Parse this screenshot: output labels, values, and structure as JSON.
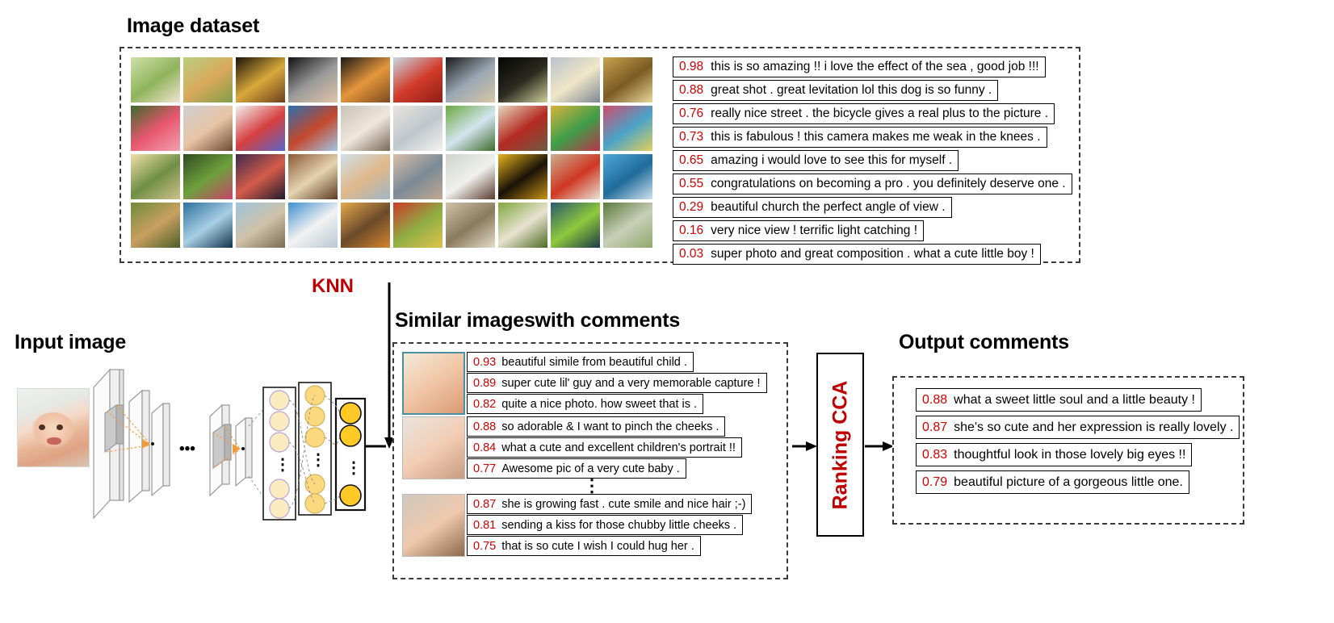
{
  "sections": {
    "dataset_title": "Image dataset",
    "input_title": "Input image",
    "similar_title": "Similar imageswith comments",
    "output_title": "Output comments",
    "knn_label": "KNN",
    "ranking_label": "Ranking CCA"
  },
  "colors": {
    "score_red": "#d00000",
    "label_red": "#c00000",
    "box_border": "#000000",
    "dash_border": "#3a3a3a",
    "neuron_yellow": "#ffc926",
    "neuron_pale": "#fcd97f",
    "neuron_lighter": "#fde8b5"
  },
  "dataset_comments": [
    {
      "score": "0.98",
      "text": "this is so amazing !! i love the effect of the sea , good job !!!"
    },
    {
      "score": "0.88",
      "text": "great shot . great levitation lol this dog is so funny ."
    },
    {
      "score": "0.76",
      "text": "really nice street . the bicycle gives a real plus to the picture ."
    },
    {
      "score": "0.73",
      "text": "this is fabulous ! this camera makes me weak in the knees ."
    },
    {
      "score": "0.65",
      "text": "amazing i would love to see this for myself ."
    },
    {
      "score": "0.55",
      "text": "congratulations on becoming a pro . you definitely deserve one ."
    },
    {
      "score": "0.29",
      "text": "beautiful church the perfect angle of view ."
    },
    {
      "score": "0.16",
      "text": "very nice view ! terrific light catching !"
    },
    {
      "score": "0.03",
      "text": "super photo and great composition . what a cute little boy !"
    }
  ],
  "similar_groups": [
    {
      "thumb": "smiling-baby-white-hat",
      "comments": [
        {
          "score": "0.93",
          "text": "beautiful simile from beautiful child ."
        },
        {
          "score": "0.89",
          "text": "super cute lil' guy and a very memorable capture !"
        },
        {
          "score": "0.82",
          "text": "quite a nice photo. how sweet that is ."
        }
      ]
    },
    {
      "thumb": "baby-with-headband",
      "comments": [
        {
          "score": "0.88",
          "text": "so adorable & I want to pinch the cheeks ."
        },
        {
          "score": "0.84",
          "text": "what a cute and excellent children's portrait !!"
        },
        {
          "score": "0.77",
          "text": "Awesome pic of a very cute baby ."
        }
      ]
    },
    {
      "thumb": "toddler-spiky-hair",
      "comments": [
        {
          "score": "0.87",
          "text": "she is growing fast . cute smile and nice hair ;-)"
        },
        {
          "score": "0.81",
          "text": "sending a kiss for those chubby little cheeks ."
        },
        {
          "score": "0.75",
          "text": "that is so cute I wish I could hug her ."
        }
      ]
    }
  ],
  "output_comments": [
    {
      "score": "0.88",
      "text": "what a sweet little soul and a little beauty !"
    },
    {
      "score": "0.87",
      "text": "she's so cute and her expression is really lovely ."
    },
    {
      "score": "0.83",
      "text": "thoughtful look in those lovely big eyes !!"
    },
    {
      "score": "0.79",
      "text": "beautiful picture of a gorgeous little one."
    }
  ],
  "dataset_thumbs": [
    "baby-on-grass",
    "golden-dog-running",
    "girl-dark-hair-ornament",
    "baby-grey-hat",
    "sunset-lake-reflection",
    "red-autumn-leaves",
    "city-skyline-framed",
    "black-insect-macro",
    "champagne-glasses",
    "yellow-alley-street",
    "pink-dahlia-flower",
    "toddler-touching-ear",
    "colored-pens-craft",
    "golden-gate-bridge",
    "chihuahua-dog",
    "window-white-curtain",
    "green-field-mountains",
    "red-rose-open-book",
    "festival-dancers-costume",
    "colorful-city-street",
    "couple-walking-field",
    "two-people-park-path",
    "city-dusk-waterfront",
    "rocking-horse-interior",
    "beach-sunset-clouds",
    "car-on-road-dusk",
    "woman-white-dress",
    "horses-silhouette-sunset",
    "dog-red-sweater",
    "seaside-blue-bay",
    "lion-cubs-grass",
    "blue-glass-building",
    "cathedral-rainbow",
    "white-windmill-blade",
    "tower-sunset",
    "autumn-trees-colorful",
    "cathedral-ceiling-symmetry",
    "owl-flying-green",
    "blue-green-foliage",
    "canal-tree-lined"
  ],
  "input_image_thumb": "smiling-baby-white-towel",
  "cnn": {
    "ellipsis": "•••",
    "vertical_ellipsis": "⋮"
  }
}
